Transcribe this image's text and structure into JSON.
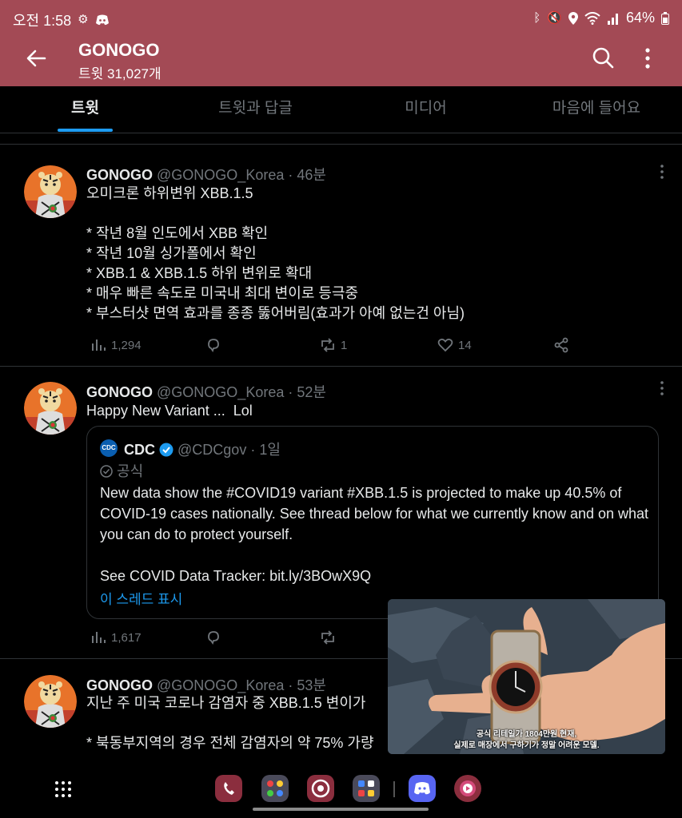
{
  "status_bar": {
    "time": "오전 1:58",
    "battery": "64%",
    "icons": [
      "notification-icon",
      "discord-icon",
      "bluetooth-icon",
      "mute-icon",
      "location-icon",
      "wifi-icon",
      "signal-icon",
      "battery-icon"
    ]
  },
  "header": {
    "title": "GONOGO",
    "subtitle": "트윗 31,027개",
    "bg_color": "#a34a55"
  },
  "tabs": [
    {
      "label": "트윗",
      "active": true
    },
    {
      "label": "트윗과 답글",
      "active": false
    },
    {
      "label": "미디어",
      "active": false
    },
    {
      "label": "마음에 들어요",
      "active": false
    }
  ],
  "accent_color": "#1d9bf0",
  "tweets": [
    {
      "name": "GONOGO",
      "meta": "@GONOGO_Korea · 46분",
      "text": "오미크론 하위변위 XBB.1.5\n\n* 작년 8월 인도에서 XBB 확인\n* 작년 10월 싱가폴에서 확인\n* XBB.1 & XBB.1.5 하위 변위로 확대\n* 매우 빠른 속도로 미국내 최대 변이로 등극중\n* 부스터샷 면역 효과를 종종 뚫어버림(효과가 아예 없는건 아님)",
      "views": "1,294",
      "retweets": "1",
      "likes": "14"
    },
    {
      "name": "GONOGO",
      "meta": "@GONOGO_Korea · 52분",
      "text": "Happy New Variant ...  Lol",
      "views": "1,617",
      "quote": {
        "logo": "CDC",
        "name": "CDC",
        "meta": "@CDCgov · 1일",
        "badge": "공식",
        "text": "New data show the #COVID19 variant #XBB.1.5 is projected to make up 40.5% of COVID-19 cases nationally. See thread below for what we currently know and on what you can do to protect yourself.",
        "tracker": "See COVID Data Tracker: bit.ly/3BOwX9Q",
        "thread_link": "이 스레드 표시"
      }
    },
    {
      "name": "GONOGO",
      "meta": "@GONOGO_Korea · 53분",
      "text": "지난 주 미국 코로나 감염자 중 XBB.1.5 변이가 \n\n* 북동부지역의 경우 전체 감염자의 약 75% 가량"
    }
  ],
  "pip_video": {
    "caption_line1": "공식 리테일가 1804만원 현재,",
    "caption_line2": "실제로 매장에서 구하기가 정말 어려운 모델."
  },
  "dock": {
    "apps": [
      "phone-app-icon",
      "app-folder-icon",
      "chrome-app-icon",
      "app-folder-2-icon",
      "discord-app-icon",
      "music-app-icon"
    ]
  }
}
